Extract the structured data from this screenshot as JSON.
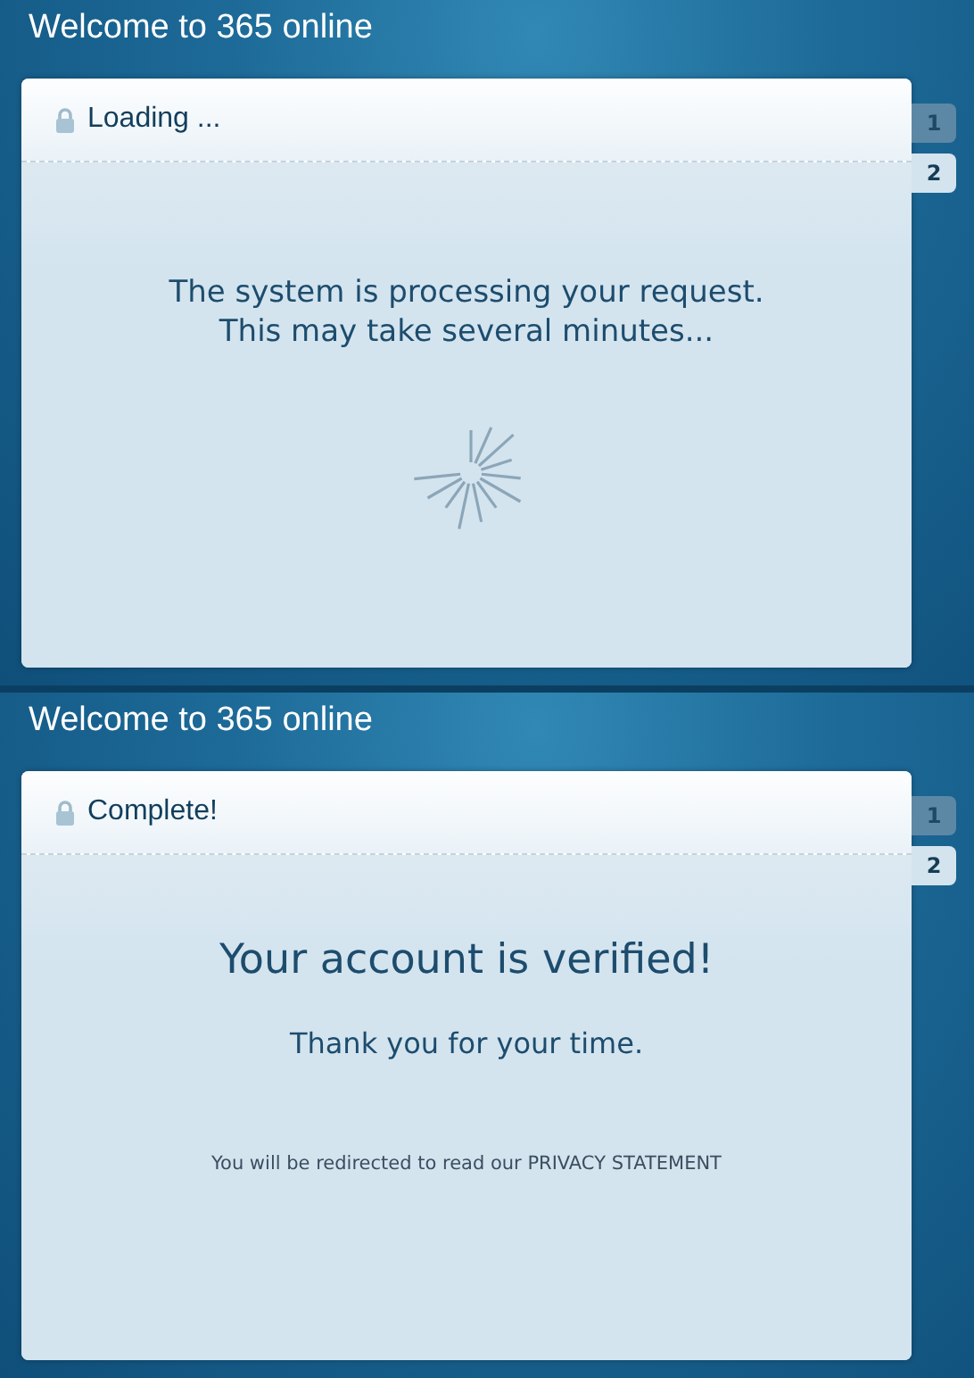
{
  "screens": [
    {
      "title": "Welcome to 365 online",
      "heading": "Loading ...",
      "kind": "loading",
      "lines": [
        "The system is processing your request.",
        "This may take several minutes..."
      ],
      "tabs": [
        {
          "label": "1",
          "selected": false
        },
        {
          "label": "2",
          "selected": true
        }
      ]
    },
    {
      "title": "Welcome to 365 online",
      "heading": "Complete!",
      "kind": "complete",
      "headline": "Your account is verified!",
      "message": "Thank you for your time.",
      "note": "You will be redirected to read our PRIVACY STATEMENT",
      "tabs": [
        {
          "label": "1",
          "selected": false
        },
        {
          "label": "2",
          "selected": true
        }
      ]
    }
  ]
}
